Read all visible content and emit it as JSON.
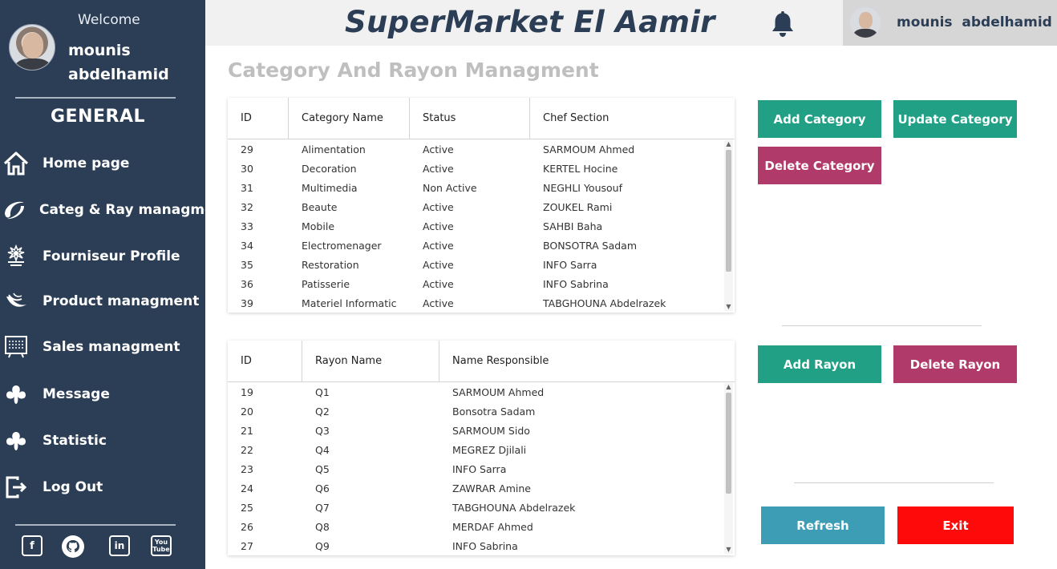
{
  "sidebar": {
    "welcome": "Welcome",
    "user_name": "mounis abdelhamid",
    "section": "GENERAL",
    "items": [
      {
        "label": "Home page",
        "icon": "home-icon"
      },
      {
        "label": "Categ & Ray managment",
        "icon": "category-icon"
      },
      {
        "label": "Fourniseur Profile",
        "icon": "supplier-icon"
      },
      {
        "label": "Product managment",
        "icon": "product-icon"
      },
      {
        "label": "Sales managment",
        "icon": "sales-icon"
      },
      {
        "label": "Message",
        "icon": "message-icon"
      },
      {
        "label": "Statistic",
        "icon": "statistic-icon"
      },
      {
        "label": "Log Out",
        "icon": "logout-icon"
      }
    ],
    "social": [
      "facebook-icon",
      "github-icon",
      "linkedin-icon",
      "youtube-icon"
    ]
  },
  "header": {
    "brand": "SuperMarket El Aamir",
    "user_name": "mounis  abdelhamid",
    "bell_icon": "bell-icon"
  },
  "page_title": "Category And Rayon Managment",
  "category_table": {
    "columns": [
      "ID",
      "Category Name",
      "Status",
      "Chef Section"
    ],
    "rows": [
      [
        "29",
        "Alimentation",
        "Active",
        "SARMOUM Ahmed"
      ],
      [
        "30",
        "Decoration",
        "Active",
        "KERTEL Hocine"
      ],
      [
        "31",
        "Multimedia",
        "Non Active",
        "NEGHLI Yousouf"
      ],
      [
        "32",
        "Beaute",
        "Active",
        "ZOUKEL Rami"
      ],
      [
        "33",
        "Mobile",
        "Active",
        "SAHBI Baha"
      ],
      [
        "34",
        "Electromenager",
        "Active",
        "BONSOTRA Sadam"
      ],
      [
        "35",
        "Restoration",
        "Active",
        "INFO Sarra"
      ],
      [
        "36",
        "Patisserie",
        "Active",
        "INFO Sabrina"
      ],
      [
        "39",
        "Materiel Informatic",
        "Active",
        "TABGHOUNA Abdelrazek"
      ]
    ]
  },
  "rayon_table": {
    "columns": [
      "ID",
      "Rayon Name",
      "Name Responsible"
    ],
    "rows": [
      [
        "19",
        "Q1",
        "SARMOUM Ahmed"
      ],
      [
        "20",
        "Q2",
        "Bonsotra Sadam"
      ],
      [
        "21",
        "Q3",
        "SARMOUM Sido"
      ],
      [
        "22",
        "Q4",
        "MEGREZ Djilali"
      ],
      [
        "23",
        "Q5",
        "INFO Sarra"
      ],
      [
        "24",
        "Q6",
        "ZAWRAR Amine"
      ],
      [
        "25",
        "Q7",
        "TABGHOUNA Abdelrazek"
      ],
      [
        "26",
        "Q8",
        "MERDAF Ahmed"
      ],
      [
        "27",
        "Q9",
        "INFO Sabrina"
      ]
    ]
  },
  "buttons": {
    "add_category": "Add Category",
    "update_category": "Update Category",
    "delete_category": "Delete Category",
    "add_rayon": "Add Rayon",
    "delete_rayon": "Delete Rayon",
    "refresh": "Refresh",
    "exit": "Exit"
  },
  "colors": {
    "sidebar": "#2c3e55",
    "green": "#21a085",
    "red": "#b03a6a",
    "blue": "#3d9db5",
    "exit": "#ff0a0a"
  }
}
